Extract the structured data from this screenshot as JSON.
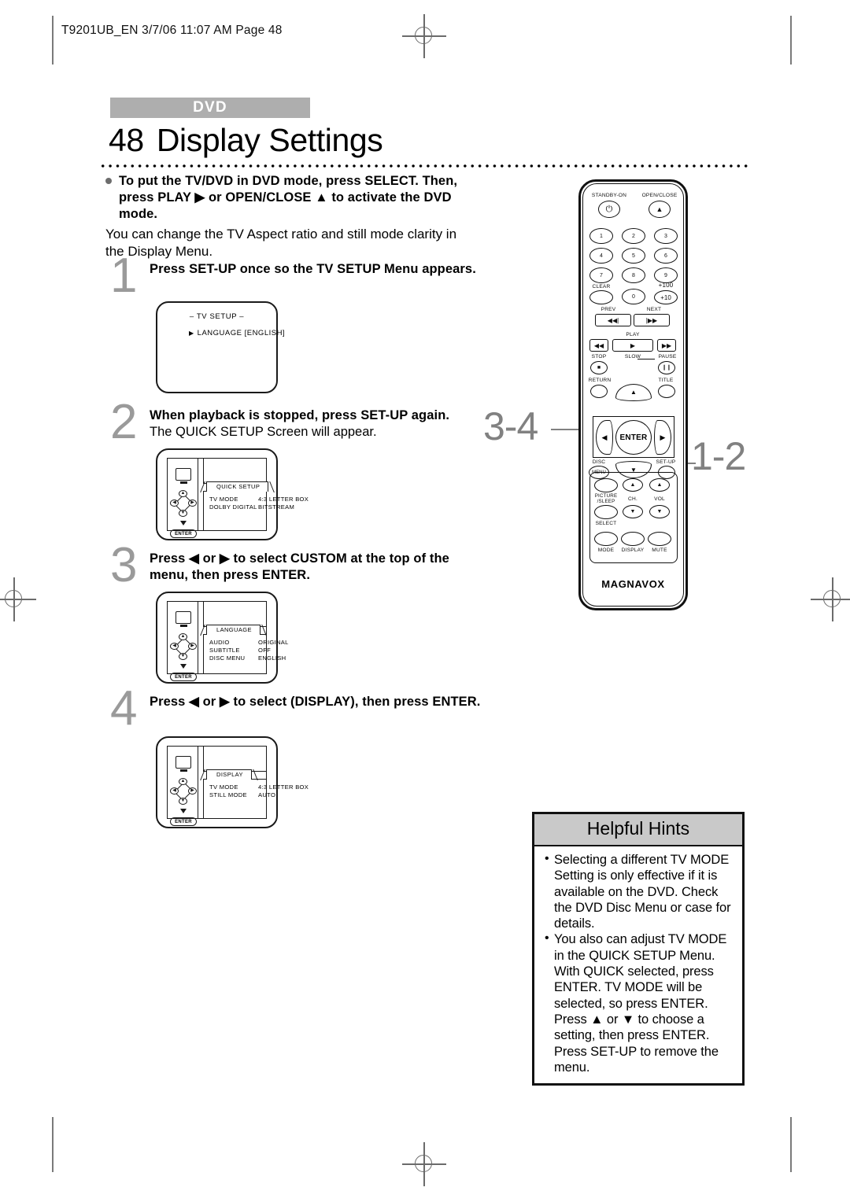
{
  "page_header": "T9201UB_EN 3/7/06 11:07 AM Page 48",
  "badge": "DVD",
  "title": {
    "number": "48",
    "text": "Display Settings"
  },
  "intro": {
    "lead": "To put the TV/DVD in DVD mode, press SELECT. Then, press PLAY ▶ or OPEN/CLOSE ▲ to activate the DVD mode.",
    "body": "You can change the TV Aspect ratio and still mode clarity in the Display Menu."
  },
  "steps": [
    {
      "number": "1",
      "bold": "Press SET-UP once so the TV SETUP Menu appears.",
      "normal": "",
      "screen": {
        "kind": "simple",
        "title": "– TV SETUP –",
        "row": "LANGUAGE  [ENGLISH]",
        "caret": "▶"
      }
    },
    {
      "number": "2",
      "bold": "When playback is stopped, press SET-UP again.",
      "normal": "The QUICK SETUP Screen will appear.",
      "screen": {
        "kind": "menu",
        "tab": "QUICK SETUP",
        "items": [
          {
            "key": "TV MODE",
            "value": "4:3 LETTER BOX"
          },
          {
            "key": "DOLBY DIGITAL",
            "value": "BITSTREAM"
          }
        ],
        "enter_label": "ENTER"
      }
    },
    {
      "number": "3",
      "bold": "Press ◀ or ▶ to select CUSTOM at the top of the menu, then press ENTER.",
      "normal": "",
      "screen": {
        "kind": "menu",
        "tab": "LANGUAGE",
        "items": [
          {
            "key": "AUDIO",
            "value": "ORIGINAL"
          },
          {
            "key": "SUBTITLE",
            "value": "OFF"
          },
          {
            "key": "DISC MENU",
            "value": "ENGLISH"
          }
        ],
        "enter_label": "ENTER"
      }
    },
    {
      "number": "4",
      "bold": "Press ◀ or ▶ to select           (DISPLAY), then press ENTER.",
      "normal": "",
      "screen": {
        "kind": "menu",
        "tab": "DISPLAY",
        "items": [
          {
            "key": "TV MODE",
            "value": "4:3 LETTER BOX"
          },
          {
            "key": "STILL MODE",
            "value": "AUTO"
          }
        ],
        "enter_label": "ENTER"
      }
    }
  ],
  "callouts": [
    {
      "text": "3-4"
    },
    {
      "text": "1-2"
    }
  ],
  "remote": {
    "brand": "MAGNAVOX",
    "labels": {
      "standby": "STANDBY-ON",
      "open_close": "OPEN/CLOSE",
      "clear": "CLEAR",
      "plus100": "+100",
      "plus10": "+10",
      "prev": "PREV",
      "next": "NEXT",
      "play": "PLAY",
      "stop": "STOP",
      "slow": "SLOW",
      "pause": "PAUSE",
      "return": "RETURN",
      "title": "TITLE",
      "enter": "ENTER",
      "disc": "DISC",
      "disc_menu": "MENU",
      "setup": "SET-UP",
      "picture_sleep_1": "PICTURE",
      "picture_sleep_2": "/SLEEP",
      "select": "SELECT",
      "ch": "CH.",
      "vol": "VOL",
      "mode": "MODE",
      "display": "DISPLAY",
      "mute": "MUTE"
    },
    "keypad": [
      "1",
      "2",
      "3",
      "4",
      "5",
      "6",
      "7",
      "8",
      "9",
      "0"
    ],
    "glyphs": {
      "power": "⏻",
      "eject": "▲",
      "prev": "◀◀|",
      "next": "|▶▶",
      "rew": "◀◀",
      "play": "▶",
      "ff": "▶▶",
      "stop": "■",
      "pause": "❙❙",
      "up": "▲",
      "down": "▼",
      "left": "◀",
      "right": "▶"
    }
  },
  "hints": {
    "heading": "Helpful Hints",
    "items": [
      "Selecting a different TV MODE Setting is only effective if it is available on the DVD. Check the DVD Disc Menu or case for details.",
      "You also can adjust TV MODE in the QUICK SETUP Menu. With QUICK selected, press ENTER. TV MODE will be selected, so press ENTER. Press ▲ or ▼ to choose a setting, then press ENTER. Press SET-UP to remove the menu."
    ],
    "bullet": "•"
  },
  "colors": {
    "badge_bg": "#aeaeae",
    "step_number": "#9a9a9a",
    "callout": "#818181",
    "hints_head_bg": "#c9c9c9",
    "regmark": "#6b6b6b"
  }
}
